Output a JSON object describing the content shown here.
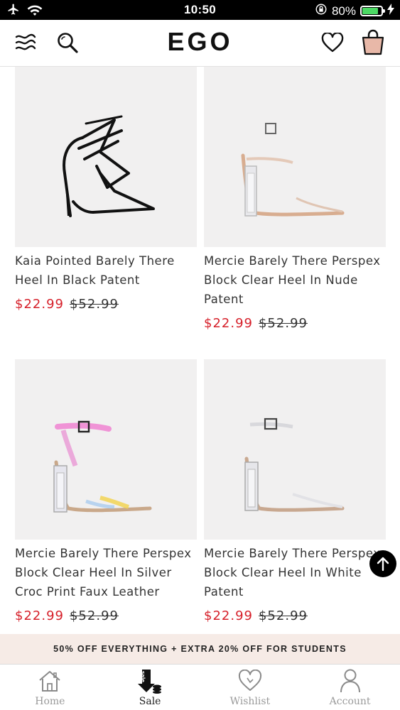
{
  "status_bar": {
    "time": "10:50",
    "battery_percent": "80%"
  },
  "header": {
    "logo": "EGO"
  },
  "products": [
    {
      "name": "Kaia Pointed Barely There Heel In Black Patent",
      "sale_price": "$22.99",
      "original_price": "$52.99",
      "image": "black-strappy-heel"
    },
    {
      "name": "Mercie Barely There Perspex Block Clear Heel In Nude Patent",
      "sale_price": "$22.99",
      "original_price": "$52.99",
      "image": "nude-perspex-heel"
    },
    {
      "name": "Mercie Barely There Perspex Block Clear Heel In Silver Croc Print Faux Leather",
      "sale_price": "$22.99",
      "original_price": "$52.99",
      "image": "iridescent-perspex-heel"
    },
    {
      "name": "Mercie Barely There Perspex Block Clear Heel In White Patent",
      "sale_price": "$22.99",
      "original_price": "$52.99",
      "image": "white-perspex-heel"
    }
  ],
  "promo_banner": "50% OFF EVERYTHING + EXTRA 20% OFF FOR STUDENTS",
  "tabs": [
    {
      "label": "Home",
      "icon": "home-icon",
      "active": false
    },
    {
      "label": "Sale",
      "icon": "sale-tag-icon",
      "active": true
    },
    {
      "label": "Wishlist",
      "icon": "heart-icon",
      "active": false
    },
    {
      "label": "Account",
      "icon": "person-icon",
      "active": false
    }
  ],
  "colors": {
    "sale_price": "#d6202a",
    "promo_bg": "#f6ebe6",
    "bag_fill": "#e8b8a8",
    "battery": "#4cd964"
  }
}
